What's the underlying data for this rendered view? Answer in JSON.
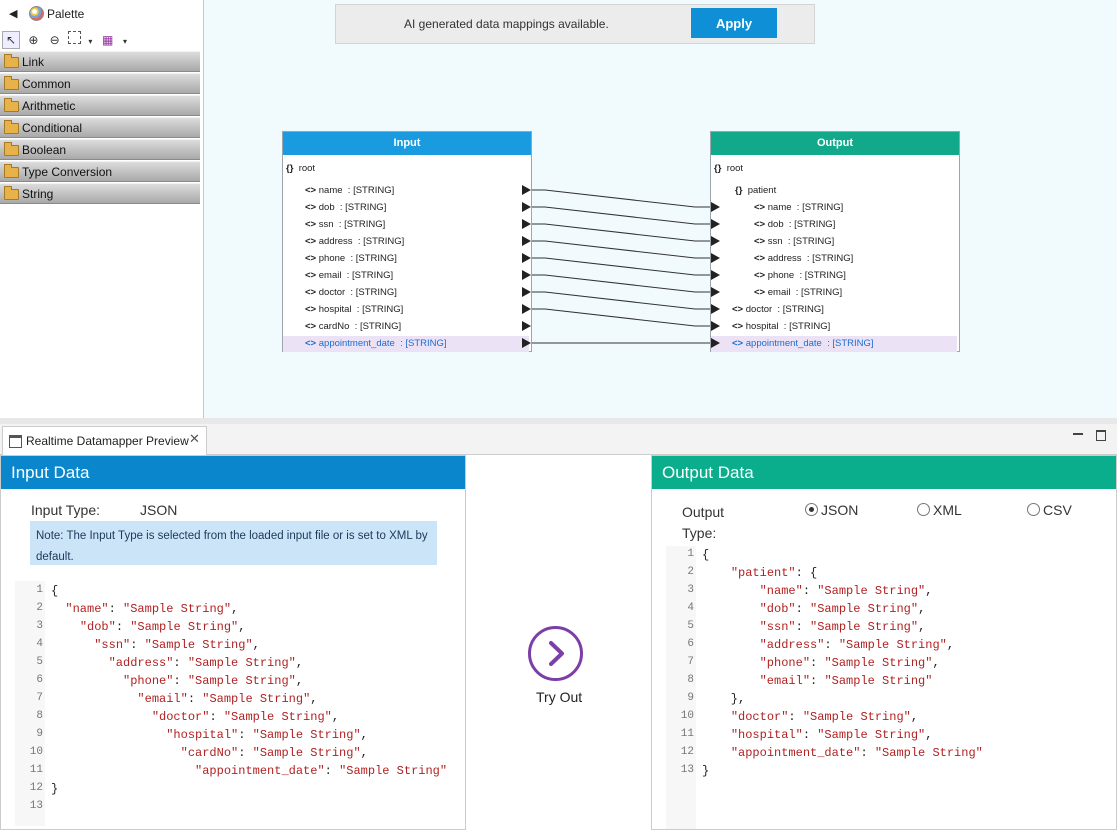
{
  "palette": {
    "title": "Palette",
    "drawers": [
      "Link",
      "Common",
      "Arithmetic",
      "Conditional",
      "Boolean",
      "Type Conversion",
      "String"
    ]
  },
  "canvas": {
    "ai_message": "AI generated data mappings available.",
    "apply_label": "Apply",
    "input_box": {
      "title": "Input",
      "root": "root",
      "fields": [
        {
          "name": "name",
          "type": "[STRING]"
        },
        {
          "name": "dob",
          "type": "[STRING]"
        },
        {
          "name": "ssn",
          "type": "[STRING]"
        },
        {
          "name": "address",
          "type": "[STRING]"
        },
        {
          "name": "phone",
          "type": "[STRING]"
        },
        {
          "name": "email",
          "type": "[STRING]"
        },
        {
          "name": "doctor",
          "type": "[STRING]"
        },
        {
          "name": "hospital",
          "type": "[STRING]"
        },
        {
          "name": "cardNo",
          "type": "[STRING]"
        },
        {
          "name": "appointment_date",
          "type": "[STRING]"
        }
      ]
    },
    "output_box": {
      "title": "Output",
      "root": "root",
      "group": "patient",
      "group_fields": [
        {
          "name": "name",
          "type": "[STRING]"
        },
        {
          "name": "dob",
          "type": "[STRING]"
        },
        {
          "name": "ssn",
          "type": "[STRING]"
        },
        {
          "name": "address",
          "type": "[STRING]"
        },
        {
          "name": "phone",
          "type": "[STRING]"
        },
        {
          "name": "email",
          "type": "[STRING]"
        }
      ],
      "fields": [
        {
          "name": "doctor",
          "type": "[STRING]"
        },
        {
          "name": "hospital",
          "type": "[STRING]"
        },
        {
          "name": "appointment_date",
          "type": "[STRING]"
        }
      ]
    }
  },
  "preview": {
    "tab_label": "Realtime Datamapper Preview",
    "input_panel": {
      "title": "Input Data",
      "type_label": "Input Type:",
      "type_value": "JSON",
      "note": "Note: The Input Type is selected from the loaded input file or is set to XML by default.",
      "code_lines": [
        "{",
        "  \"name\": \"Sample String\",",
        "    \"dob\": \"Sample String\",",
        "      \"ssn\": \"Sample String\",",
        "        \"address\": \"Sample String\",",
        "          \"phone\": \"Sample String\",",
        "            \"email\": \"Sample String\",",
        "              \"doctor\": \"Sample String\",",
        "                \"hospital\": \"Sample String\",",
        "                  \"cardNo\": \"Sample String\",",
        "                    \"appointment_date\": \"Sample String\"",
        "}",
        ""
      ]
    },
    "try_out_label": "Try Out",
    "output_panel": {
      "title": "Output Data",
      "type_label": "Output Type:",
      "options": [
        "JSON",
        "XML",
        "CSV"
      ],
      "selected": "JSON",
      "code_lines": [
        "{",
        "    \"patient\": {",
        "        \"name\": \"Sample String\",",
        "        \"dob\": \"Sample String\",",
        "        \"ssn\": \"Sample String\",",
        "        \"address\": \"Sample String\",",
        "        \"phone\": \"Sample String\",",
        "        \"email\": \"Sample String\"",
        "    },",
        "    \"doctor\": \"Sample String\",",
        "    \"hospital\": \"Sample String\",",
        "    \"appointment_date\": \"Sample String\"",
        "}"
      ]
    }
  },
  "colors": {
    "input_header": "#1a9be0",
    "output_header": "#12a98a",
    "input_panel_header": "#0a86cc",
    "output_panel_header": "#0bae8c",
    "try_out": "#7b3fa6",
    "note_bg": "#cce4f7"
  }
}
